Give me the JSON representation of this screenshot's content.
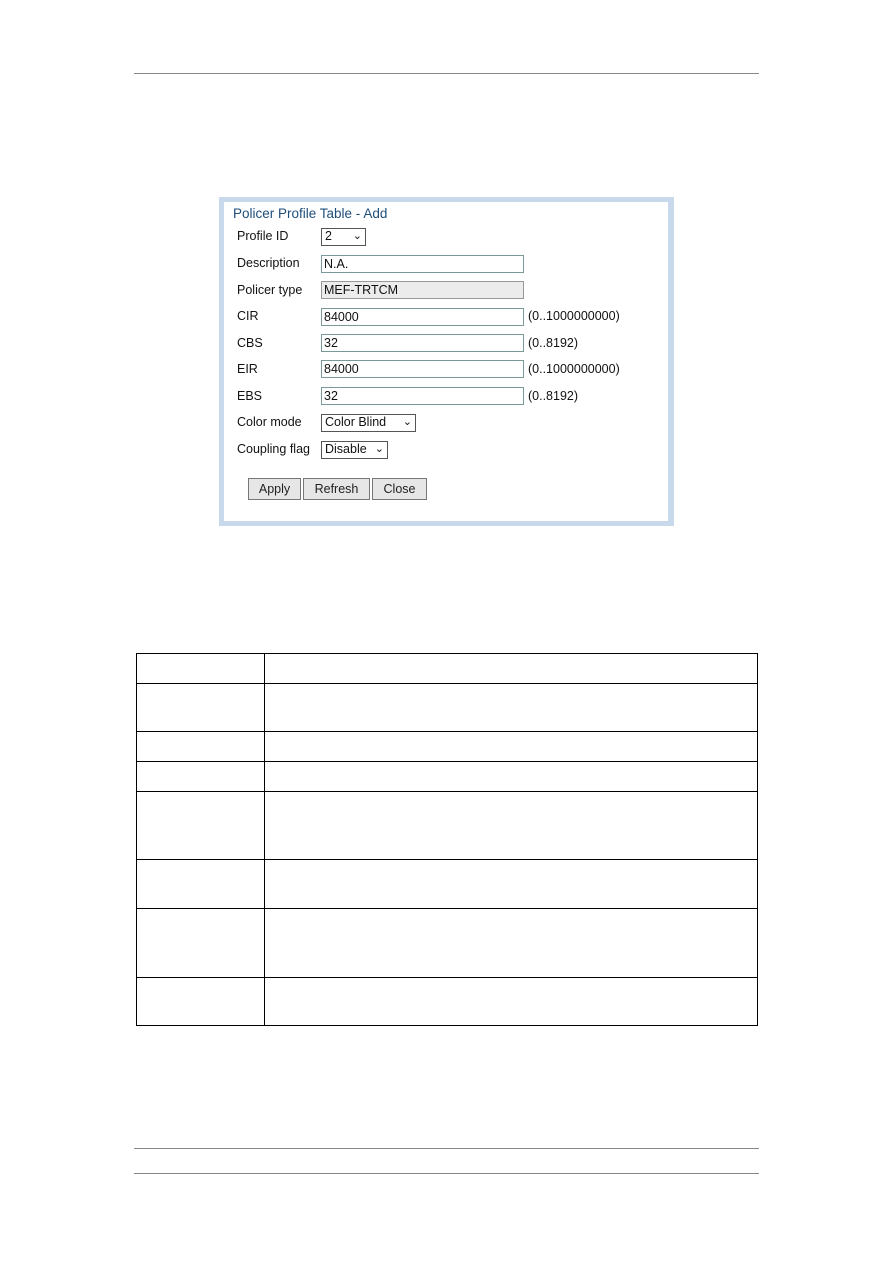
{
  "dialog": {
    "title": "Policer Profile Table - Add",
    "fields": [
      {
        "label": "Profile ID",
        "value": "2",
        "type": "select"
      },
      {
        "label": "Description",
        "value": "N.A.",
        "type": "text"
      },
      {
        "label": "Policer type",
        "value": "MEF-TRTCM",
        "type": "readonly"
      },
      {
        "label": "CIR",
        "value": "84000",
        "range": "(0..1000000000)"
      },
      {
        "label": "CBS",
        "value": "32",
        "range": "(0..8192)"
      },
      {
        "label": "EIR",
        "value": "84000",
        "range": "(0..1000000000)"
      },
      {
        "label": "EBS",
        "value": "32",
        "range": "(0..8192)"
      },
      {
        "label": "Color mode",
        "value": "Color Blind",
        "type": "select"
      },
      {
        "label": "Coupling flag",
        "value": "Disable",
        "type": "select"
      }
    ],
    "buttons": {
      "apply": "Apply",
      "refresh": "Refresh",
      "close": "Close"
    },
    "title_color": "#1f4e7a"
  }
}
